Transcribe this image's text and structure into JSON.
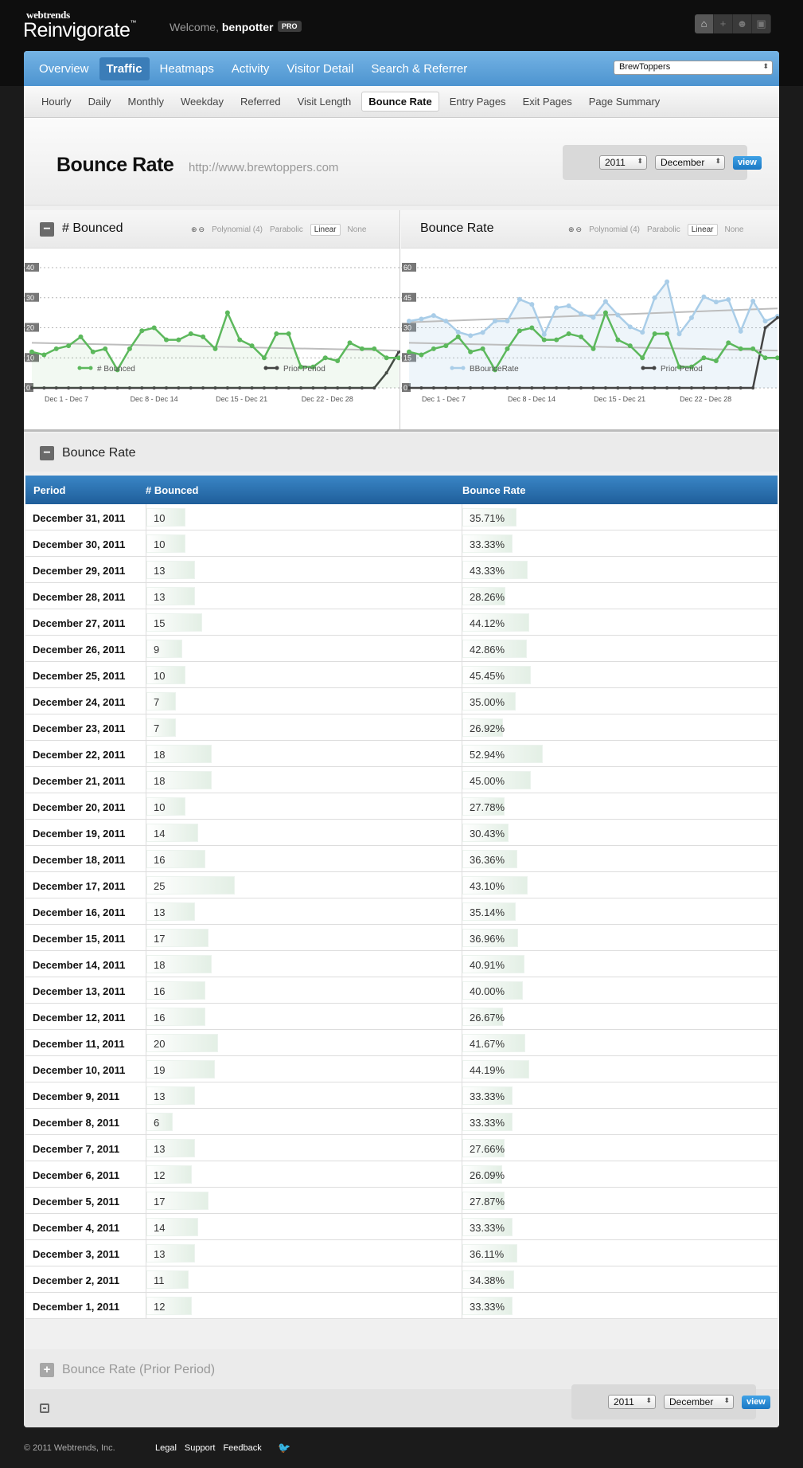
{
  "app": {
    "brand_small": "webtrends",
    "brand_big": "Reinvigorate",
    "brand_tm": "™"
  },
  "header": {
    "welcome_prefix": "Welcome,",
    "username": "benpotter",
    "badge": "PRO"
  },
  "top_icons": [
    "home-icon",
    "plus-icon",
    "users-icon",
    "lock-icon"
  ],
  "main_nav": {
    "items": [
      "Overview",
      "Traffic",
      "Heatmaps",
      "Activity",
      "Visitor Detail",
      "Search & Referrer"
    ],
    "active": "Traffic",
    "site_select": "BrewToppers"
  },
  "sub_nav": {
    "items": [
      "Hourly",
      "Daily",
      "Monthly",
      "Weekday",
      "Referred",
      "Visit Length",
      "Bounce Rate",
      "Entry Pages",
      "Exit Pages",
      "Page Summary"
    ],
    "active": "Bounce Rate"
  },
  "page": {
    "title": "Bounce Rate",
    "url": "http://www.brewtoppers.com"
  },
  "date_picker": {
    "year": "2011",
    "month": "December",
    "view_label": "view"
  },
  "fit_options": {
    "zoom_in": "⊕",
    "zoom_out": "⊖",
    "poly": "Polynomial (4)",
    "para": "Parabolic",
    "linear": "Linear",
    "none": "None"
  },
  "colors": {
    "nav_blue": "#4d94d0",
    "green": "#5cb85c",
    "light_blue": "#a9cde8",
    "prior": "#555555",
    "table_head": "#2a6faf"
  },
  "chart_data": [
    {
      "type": "line",
      "title": "# Bounced",
      "x": [
        "Dec 1",
        "Dec 2",
        "Dec 3",
        "Dec 4",
        "Dec 5",
        "Dec 6",
        "Dec 7",
        "Dec 8",
        "Dec 9",
        "Dec 10",
        "Dec 11",
        "Dec 12",
        "Dec 13",
        "Dec 14",
        "Dec 15",
        "Dec 16",
        "Dec 17",
        "Dec 18",
        "Dec 19",
        "Dec 20",
        "Dec 21",
        "Dec 22",
        "Dec 23",
        "Dec 24",
        "Dec 25",
        "Dec 26",
        "Dec 27",
        "Dec 28",
        "Dec 29",
        "Dec 30",
        "Dec 31"
      ],
      "xticks": [
        "Dec 1 - Dec 7",
        "Dec 8 - Dec 14",
        "Dec 15 - Dec 21",
        "Dec 22 - Dec 28"
      ],
      "ylim": [
        0,
        40
      ],
      "yticks": [
        "40",
        "30",
        "20",
        "10",
        "0"
      ],
      "series": [
        {
          "name": "# Bounced",
          "values": [
            12,
            11,
            13,
            14,
            17,
            12,
            13,
            6,
            13,
            19,
            20,
            16,
            16,
            18,
            17,
            13,
            25,
            16,
            14,
            10,
            18,
            18,
            7,
            7,
            10,
            9,
            15,
            13,
            13,
            10,
            10
          ]
        },
        {
          "name": "Prior Period",
          "values": [
            0,
            0,
            0,
            0,
            0,
            0,
            0,
            0,
            0,
            0,
            0,
            0,
            0,
            0,
            0,
            0,
            0,
            0,
            0,
            0,
            0,
            0,
            0,
            0,
            0,
            0,
            0,
            0,
            0,
            5,
            12
          ]
        }
      ],
      "trend": "linear"
    },
    {
      "type": "line",
      "title": "Bounce Rate",
      "x": [
        "Dec 1",
        "Dec 2",
        "Dec 3",
        "Dec 4",
        "Dec 5",
        "Dec 6",
        "Dec 7",
        "Dec 8",
        "Dec 9",
        "Dec 10",
        "Dec 11",
        "Dec 12",
        "Dec 13",
        "Dec 14",
        "Dec 15",
        "Dec 16",
        "Dec 17",
        "Dec 18",
        "Dec 19",
        "Dec 20",
        "Dec 21",
        "Dec 22",
        "Dec 23",
        "Dec 24",
        "Dec 25",
        "Dec 26",
        "Dec 27",
        "Dec 28",
        "Dec 29",
        "Dec 30",
        "Dec 31"
      ],
      "xticks": [
        "Dec 1 - Dec 7",
        "Dec 8 - Dec 14",
        "Dec 15 - Dec 21",
        "Dec 22 - Dec 28"
      ],
      "ylim": [
        0,
        60
      ],
      "yticks": [
        "60",
        "45",
        "30",
        "15",
        "0"
      ],
      "series": [
        {
          "name": "Bounce Rate",
          "values": [
            33.33,
            34.38,
            36.11,
            33.33,
            27.87,
            26.09,
            27.66,
            33.33,
            33.33,
            44.19,
            41.67,
            26.67,
            40.0,
            40.91,
            36.96,
            35.14,
            43.1,
            36.36,
            30.43,
            27.78,
            45.0,
            52.94,
            26.92,
            35.0,
            45.45,
            42.86,
            44.12,
            28.26,
            43.33,
            33.33,
            35.71
          ]
        },
        {
          "name": "# Bounced",
          "values": [
            12,
            11,
            13,
            14,
            17,
            12,
            13,
            6,
            13,
            19,
            20,
            16,
            16,
            18,
            17,
            13,
            25,
            16,
            14,
            10,
            18,
            18,
            7,
            7,
            10,
            9,
            15,
            13,
            13,
            10,
            10
          ]
        },
        {
          "name": "Prior Period",
          "values": [
            0,
            0,
            0,
            0,
            0,
            0,
            0,
            0,
            0,
            0,
            0,
            0,
            0,
            0,
            0,
            0,
            0,
            0,
            0,
            0,
            0,
            0,
            0,
            0,
            0,
            0,
            0,
            0,
            0,
            30,
            35
          ]
        }
      ],
      "trend": "linear"
    }
  ],
  "legend": {
    "bounced": "# Bounced",
    "prior": "Prior Period",
    "overlap": "BBounceRate"
  },
  "table": {
    "section_title": "Bounce Rate",
    "headers": {
      "period": "Period",
      "bounced": "# Bounced",
      "rate": "Bounce Rate"
    },
    "rows": [
      {
        "period": "December 31, 2011",
        "bounced": "10",
        "rate": "35.71%"
      },
      {
        "period": "December 30, 2011",
        "bounced": "10",
        "rate": "33.33%"
      },
      {
        "period": "December 29, 2011",
        "bounced": "13",
        "rate": "43.33%"
      },
      {
        "period": "December 28, 2011",
        "bounced": "13",
        "rate": "28.26%"
      },
      {
        "period": "December 27, 2011",
        "bounced": "15",
        "rate": "44.12%"
      },
      {
        "period": "December 26, 2011",
        "bounced": "9",
        "rate": "42.86%"
      },
      {
        "period": "December 25, 2011",
        "bounced": "10",
        "rate": "45.45%"
      },
      {
        "period": "December 24, 2011",
        "bounced": "7",
        "rate": "35.00%"
      },
      {
        "period": "December 23, 2011",
        "bounced": "7",
        "rate": "26.92%"
      },
      {
        "period": "December 22, 2011",
        "bounced": "18",
        "rate": "52.94%"
      },
      {
        "period": "December 21, 2011",
        "bounced": "18",
        "rate": "45.00%"
      },
      {
        "period": "December 20, 2011",
        "bounced": "10",
        "rate": "27.78%"
      },
      {
        "period": "December 19, 2011",
        "bounced": "14",
        "rate": "30.43%"
      },
      {
        "period": "December 18, 2011",
        "bounced": "16",
        "rate": "36.36%"
      },
      {
        "period": "December 17, 2011",
        "bounced": "25",
        "rate": "43.10%"
      },
      {
        "period": "December 16, 2011",
        "bounced": "13",
        "rate": "35.14%"
      },
      {
        "period": "December 15, 2011",
        "bounced": "17",
        "rate": "36.96%"
      },
      {
        "period": "December 14, 2011",
        "bounced": "18",
        "rate": "40.91%"
      },
      {
        "period": "December 13, 2011",
        "bounced": "16",
        "rate": "40.00%"
      },
      {
        "period": "December 12, 2011",
        "bounced": "16",
        "rate": "26.67%"
      },
      {
        "period": "December 11, 2011",
        "bounced": "20",
        "rate": "41.67%"
      },
      {
        "period": "December 10, 2011",
        "bounced": "19",
        "rate": "44.19%"
      },
      {
        "period": "December 9, 2011",
        "bounced": "13",
        "rate": "33.33%"
      },
      {
        "period": "December 8, 2011",
        "bounced": "6",
        "rate": "33.33%"
      },
      {
        "period": "December 7, 2011",
        "bounced": "13",
        "rate": "27.66%"
      },
      {
        "period": "December 6, 2011",
        "bounced": "12",
        "rate": "26.09%"
      },
      {
        "period": "December 5, 2011",
        "bounced": "17",
        "rate": "27.87%"
      },
      {
        "period": "December 4, 2011",
        "bounced": "14",
        "rate": "33.33%"
      },
      {
        "period": "December 3, 2011",
        "bounced": "13",
        "rate": "36.11%"
      },
      {
        "period": "December 2, 2011",
        "bounced": "11",
        "rate": "34.38%"
      },
      {
        "period": "December 1, 2011",
        "bounced": "12",
        "rate": "33.33%"
      }
    ]
  },
  "prior_section": {
    "title": "Bounce Rate (Prior Period)"
  },
  "footer": {
    "copyright": "© 2011 Webtrends, Inc.",
    "links": [
      "Legal",
      "Support",
      "Feedback"
    ]
  }
}
